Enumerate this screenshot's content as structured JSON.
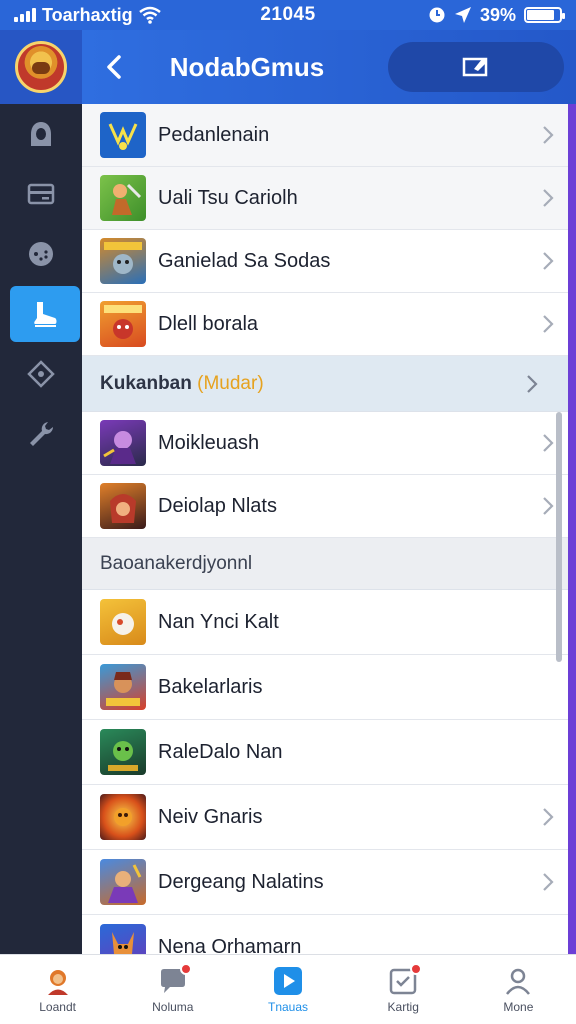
{
  "status_bar": {
    "carrier": "Toarhaxtig",
    "time": "21045",
    "battery_text": "39%",
    "battery_level": 0.85
  },
  "header": {
    "title": "NodabGmus"
  },
  "sidebar": {
    "items": [
      {
        "icon": "hooded-figure-icon",
        "active": false
      },
      {
        "icon": "card-icon",
        "active": false
      },
      {
        "icon": "gamepad-icon",
        "active": false
      },
      {
        "icon": "boot-icon",
        "active": true
      },
      {
        "icon": "puzzle-icon",
        "active": false
      },
      {
        "icon": "wrench-icon",
        "active": false
      }
    ]
  },
  "list": {
    "group_a": [
      {
        "label": "Pedanlenain",
        "thumb": "blue-emblem",
        "chevron": true
      },
      {
        "label": "Uali Tsu Cariolh",
        "thumb": "green-warrior",
        "chevron": true
      },
      {
        "label": "Ganielad Sa Sodas",
        "thumb": "blue-robot",
        "chevron": true
      },
      {
        "label": "Dlell borala",
        "thumb": "orange-hero",
        "chevron": true
      }
    ],
    "section_1": {
      "label": "Kukanban",
      "accent": "(Mudar)",
      "chevron": true
    },
    "group_b": [
      {
        "label": "Moikleuash",
        "thumb": "purple-mage",
        "chevron": true
      },
      {
        "label": "Deiolap Nlats",
        "thumb": "red-knight",
        "chevron": true
      }
    ],
    "section_2": {
      "label": "Baoanakerdjyonnl"
    },
    "group_c": [
      {
        "label": "Nan Ynci Kalt",
        "thumb": "gold-ball",
        "chevron": false
      },
      {
        "label": "Bakelarlaris",
        "thumb": "dwarf-chief",
        "chevron": false
      },
      {
        "label": "RaleDalo Nan",
        "thumb": "green-goblin",
        "chevron": false
      },
      {
        "label": "Neiv Gnaris",
        "thumb": "fire-demon",
        "chevron": true
      },
      {
        "label": "Dergeang Nalatins",
        "thumb": "blue-warrior",
        "chevron": true
      },
      {
        "label": "Nena Orhamarn",
        "thumb": "fox-warrior",
        "chevron": false
      }
    ]
  },
  "bottom_nav": [
    {
      "label": "Loandt",
      "icon": "avatar-icon",
      "active": false,
      "badge": false
    },
    {
      "label": "Noluma",
      "icon": "chat-bubble-icon",
      "active": false,
      "badge": true
    },
    {
      "label": "Tnauas",
      "icon": "play-icon",
      "active": true,
      "badge": false
    },
    {
      "label": "Kartig",
      "icon": "checklist-icon",
      "active": false,
      "badge": true
    },
    {
      "label": "Mone",
      "icon": "person-icon",
      "active": false,
      "badge": false
    }
  ],
  "colors": {
    "header_blue": "#2a66d8",
    "sidebar_dark": "#22283a",
    "active_blue": "#2d9cf0",
    "accent_orange": "#e6a21f",
    "badge_red": "#e53a3a"
  }
}
